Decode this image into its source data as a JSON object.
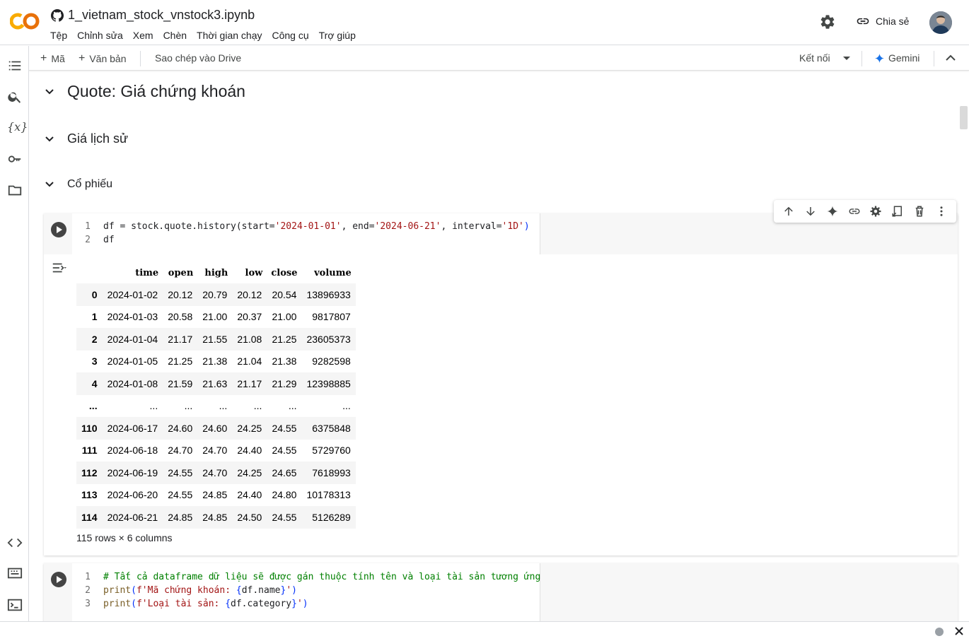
{
  "header": {
    "title": "1_vietnam_stock_vnstock3.ipynb",
    "menu": [
      "Tệp",
      "Chỉnh sửa",
      "Xem",
      "Chèn",
      "Thời gian chạy",
      "Công cụ",
      "Trợ giúp"
    ],
    "share_label": "Chia sẻ",
    "brand_colors": {
      "orange": "#F9AB00",
      "dark_orange": "#E8710A"
    }
  },
  "toolbar": {
    "add_code": "Mã",
    "add_text": "Văn bản",
    "copy_drive": "Sao chép vào Drive",
    "connect": "Kết nối",
    "gemini": "Gemini"
  },
  "sections": {
    "h1": "Quote: Giá chứng khoán",
    "h2": "Giá lịch sử",
    "h3": "Cổ phiếu"
  },
  "cell1": {
    "lines": [
      {
        "num": "1"
      },
      {
        "num": "2",
        "code": "df"
      }
    ],
    "code1": {
      "a": "df = stock.quote.history(start=",
      "s1": "'2024-01-01'",
      "b": ", end=",
      "s2": "'2024-06-21'",
      "c": ", interval=",
      "s3": "'1D'",
      "d": ")"
    }
  },
  "output": {
    "columns": [
      "",
      "time",
      "open",
      "high",
      "low",
      "close",
      "volume"
    ],
    "rows": [
      [
        "0",
        "2024-01-02",
        "20.12",
        "20.79",
        "20.12",
        "20.54",
        "13896933"
      ],
      [
        "1",
        "2024-01-03",
        "20.58",
        "21.00",
        "20.37",
        "21.00",
        "9817807"
      ],
      [
        "2",
        "2024-01-04",
        "21.17",
        "21.55",
        "21.08",
        "21.25",
        "23605373"
      ],
      [
        "3",
        "2024-01-05",
        "21.25",
        "21.38",
        "21.04",
        "21.38",
        "9282598"
      ],
      [
        "4",
        "2024-01-08",
        "21.59",
        "21.63",
        "21.17",
        "21.29",
        "12398885"
      ],
      [
        "...",
        "...",
        "...",
        "...",
        "...",
        "...",
        "..."
      ],
      [
        "110",
        "2024-06-17",
        "24.60",
        "24.60",
        "24.25",
        "24.55",
        "6375848"
      ],
      [
        "111",
        "2024-06-18",
        "24.70",
        "24.70",
        "24.40",
        "24.55",
        "5729760"
      ],
      [
        "112",
        "2024-06-19",
        "24.55",
        "24.70",
        "24.25",
        "24.65",
        "7618993"
      ],
      [
        "113",
        "2024-06-20",
        "24.55",
        "24.85",
        "24.40",
        "24.80",
        "10178313"
      ],
      [
        "114",
        "2024-06-21",
        "24.85",
        "24.85",
        "24.50",
        "24.55",
        "5126289"
      ]
    ],
    "summary": "115 rows × 6 columns"
  },
  "cell2": {
    "lines": [
      {
        "num": "1",
        "comment": "# Tất cả dataframe dữ liệu sẽ được gán thuộc tính tên và loại tài sản tương ứng"
      },
      {
        "num": "2",
        "fn": "print",
        "fstr": "f'Mã chứng khoán: ",
        "expr": "df.name",
        "tail": "'"
      },
      {
        "num": "3",
        "fn": "print",
        "fstr": "f'Loại tài sản: ",
        "expr": "df.category",
        "tail": "'"
      }
    ]
  }
}
